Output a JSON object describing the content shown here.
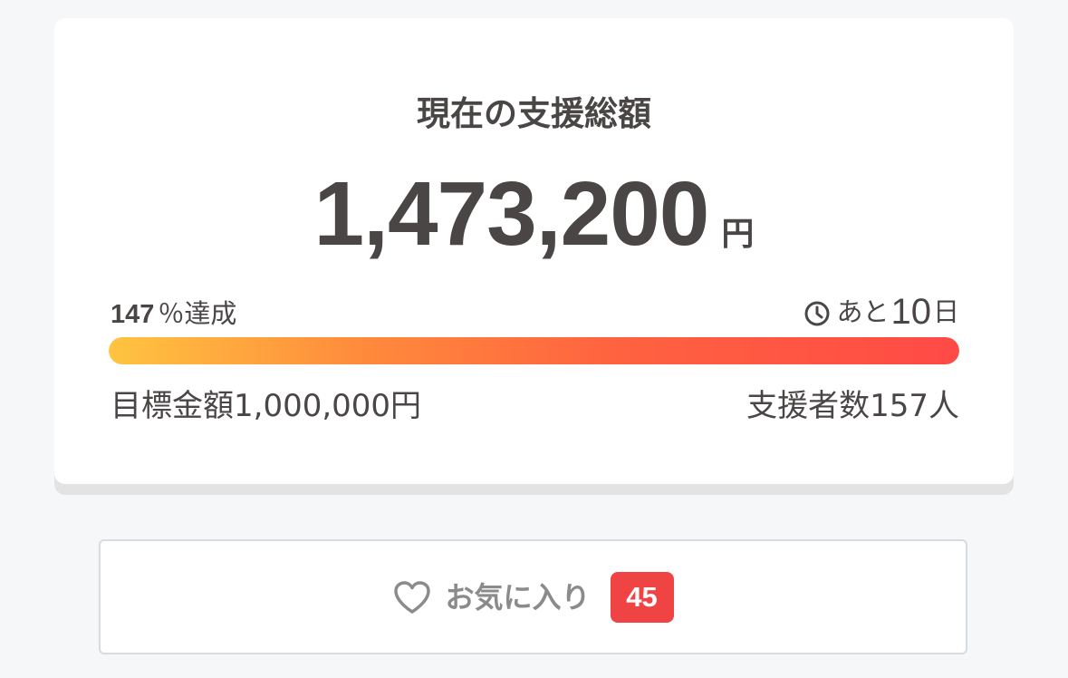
{
  "funding": {
    "title": "現在の支援総額",
    "amount": "1,473,200",
    "currency_unit": "円",
    "achievement_percent": "147",
    "achievement_suffix": "％達成",
    "remaining_prefix": "あと",
    "remaining_days": "10",
    "remaining_suffix": "日",
    "progress_fraction": 1.0,
    "goal_text": "目標金額1,000,000円",
    "supporters_text": "支援者数157人"
  },
  "favorite": {
    "label": "お気に入り",
    "count": "45"
  },
  "icons": {
    "clock": "clock-icon",
    "heart": "heart-icon"
  },
  "colors": {
    "progress_start": "#ffc440",
    "progress_end": "#ff4a46",
    "badge": "#f04444"
  }
}
